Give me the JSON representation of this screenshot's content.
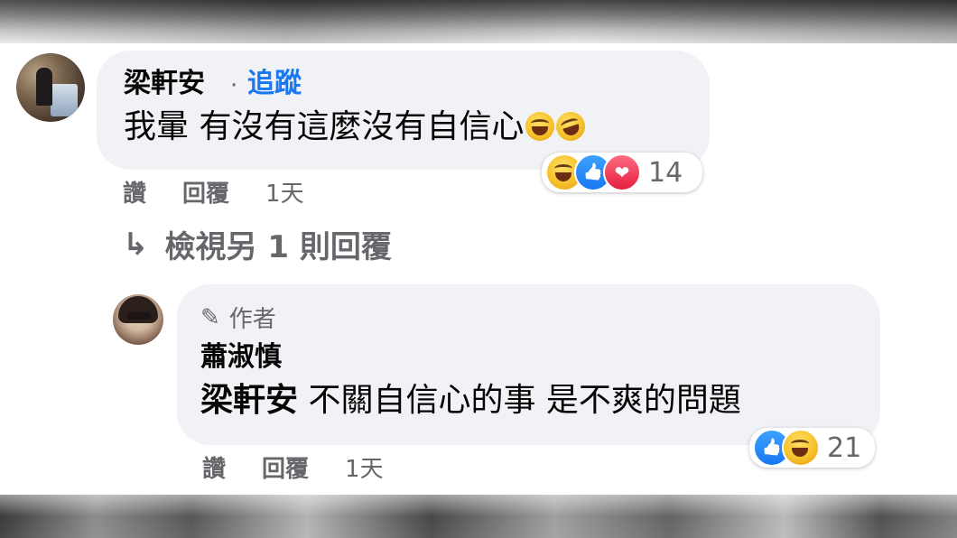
{
  "comment": {
    "author": "梁軒安",
    "separator": "·",
    "follow": "追蹤",
    "text": "我暈 有沒有這麼沒有自信心",
    "reaction_count": "14",
    "actions": {
      "like": "讚",
      "reply": "回覆",
      "time": "1天"
    }
  },
  "view_replies": "檢視另 1 則回覆",
  "reply": {
    "badge": "作者",
    "author": "蕭淑慎",
    "mention": "梁軒安",
    "text": "不關自信心的事 是不爽的問題",
    "reaction_count": "21",
    "actions": {
      "like": "讚",
      "reply": "回覆",
      "time": "1天"
    }
  },
  "colors": {
    "bubble": "#f0f2f5",
    "link": "#1877f2",
    "secondary": "#65676b"
  },
  "icons": {
    "arrow": "↳",
    "pencil": "✎"
  }
}
